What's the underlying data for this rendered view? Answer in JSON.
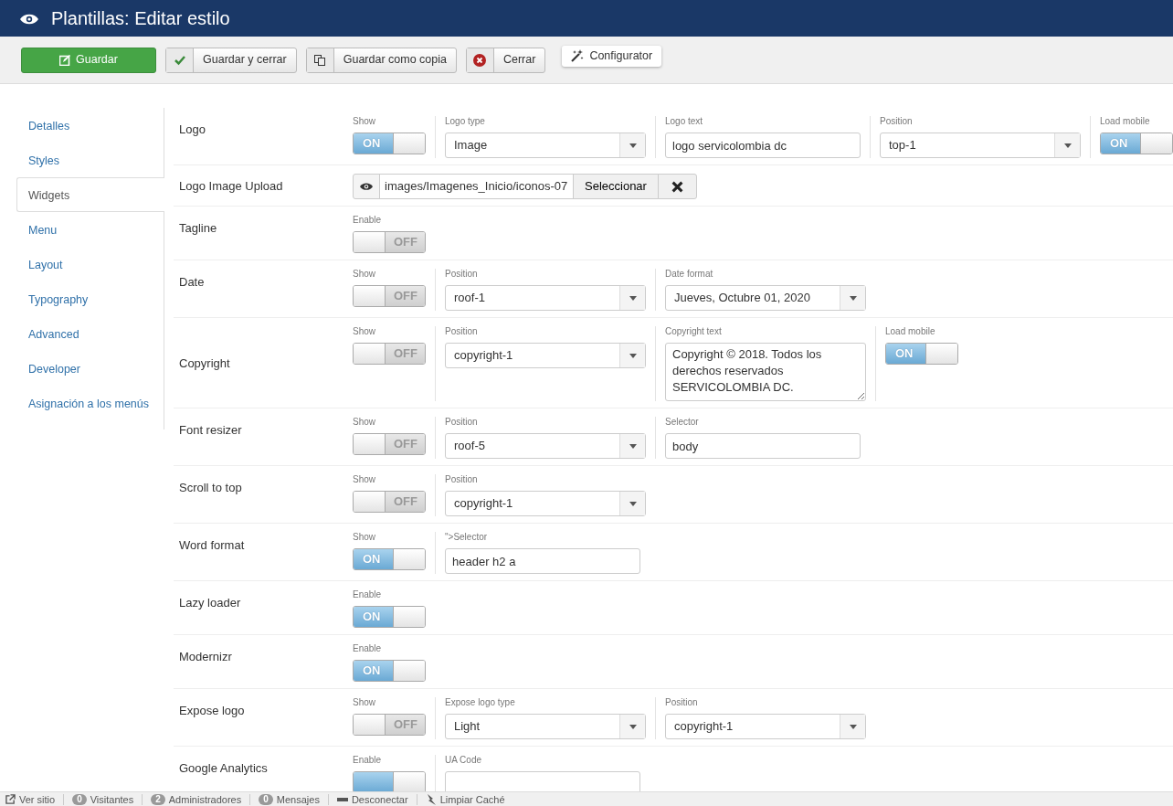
{
  "header": {
    "title": "Plantillas: Editar estilo"
  },
  "toolbar": [
    {
      "kind": "save",
      "label": "Guardar"
    },
    {
      "kind": "save-close",
      "label": "Guardar y cerrar"
    },
    {
      "kind": "save-copy",
      "label": "Guardar como copia"
    },
    {
      "kind": "close",
      "label": "Cerrar"
    },
    {
      "kind": "configurator",
      "label": "Configurator"
    }
  ],
  "sidebar": {
    "tabs": [
      {
        "label": "Detalles",
        "selected": false
      },
      {
        "label": "Styles",
        "selected": false
      },
      {
        "label": "Widgets",
        "selected": true
      },
      {
        "label": "Menu",
        "selected": false
      },
      {
        "label": "Layout",
        "selected": false
      },
      {
        "label": "Typography",
        "selected": false
      },
      {
        "label": "Advanced",
        "selected": false
      },
      {
        "label": "Developer",
        "selected": false
      },
      {
        "label": "Asignación a los menús",
        "selected": false
      }
    ]
  },
  "rows": [
    {
      "label": "Logo",
      "fields": [
        {
          "kind": "toggle",
          "caption": "Show",
          "on": true,
          "text": "ON"
        },
        {
          "kind": "select",
          "caption": "Logo type",
          "value": "Image"
        },
        {
          "kind": "text",
          "caption": "Logo text",
          "value": "logo servicolombia dc"
        },
        {
          "kind": "select",
          "caption": "Position",
          "value": "top-1"
        },
        {
          "kind": "toggle",
          "caption": "Load mobile",
          "on": true,
          "text": "ON"
        }
      ]
    },
    {
      "label": "Logo Image Upload",
      "fields": [
        {
          "kind": "media",
          "value": "images/Imagenes_Inicio/iconos-07",
          "button": "Seleccionar"
        }
      ]
    },
    {
      "label": "Tagline",
      "fields": [
        {
          "kind": "toggle",
          "caption": "Enable",
          "on": false,
          "text": "OFF"
        }
      ]
    },
    {
      "label": "Date",
      "fields": [
        {
          "kind": "toggle",
          "caption": "Show",
          "on": false,
          "text": "OFF"
        },
        {
          "kind": "select",
          "caption": "Position",
          "value": "roof-1"
        },
        {
          "kind": "select",
          "caption": "Date format",
          "value": "Jueves, Octubre 01, 2020"
        }
      ]
    },
    {
      "label": "Copyright",
      "fields": [
        {
          "kind": "toggle",
          "caption": "Show",
          "on": false,
          "text": "OFF"
        },
        {
          "kind": "select",
          "caption": "Position",
          "value": "copyright-1"
        },
        {
          "kind": "textarea",
          "caption": "Copyright text",
          "value": "Copyright © 2018. Todos los derechos reservados SERVICOLOMBIA DC."
        },
        {
          "kind": "toggle",
          "caption": "Load mobile",
          "on": true,
          "text": "ON"
        }
      ]
    },
    {
      "label": "Font resizer",
      "fields": [
        {
          "kind": "toggle",
          "caption": "Show",
          "on": false,
          "text": "OFF"
        },
        {
          "kind": "select",
          "caption": "Position",
          "value": "roof-5"
        },
        {
          "kind": "text",
          "caption": "Selector",
          "value": "body"
        }
      ]
    },
    {
      "label": "Scroll to top",
      "fields": [
        {
          "kind": "toggle",
          "caption": "Show",
          "on": false,
          "text": "OFF"
        },
        {
          "kind": "select",
          "caption": "Position",
          "value": "copyright-1"
        }
      ]
    },
    {
      "label": "Word format",
      "fields": [
        {
          "kind": "toggle",
          "caption": "Show",
          "on": true,
          "text": "ON"
        },
        {
          "kind": "text",
          "caption": "\">Selector",
          "value": "header h2 a"
        }
      ]
    },
    {
      "label": "Lazy loader",
      "fields": [
        {
          "kind": "toggle",
          "caption": "Enable",
          "on": true,
          "text": "ON"
        }
      ]
    },
    {
      "label": "Modernizr",
      "fields": [
        {
          "kind": "toggle",
          "caption": "Enable",
          "on": true,
          "text": "ON"
        }
      ]
    },
    {
      "label": "Expose logo",
      "fields": [
        {
          "kind": "toggle",
          "caption": "Show",
          "on": false,
          "text": "OFF"
        },
        {
          "kind": "select",
          "caption": "Expose logo type",
          "value": "Light"
        },
        {
          "kind": "select",
          "caption": "Position",
          "value": "copyright-1"
        }
      ]
    },
    {
      "label": "Google Analytics",
      "fields": [
        {
          "kind": "toggle",
          "caption": "Enable",
          "on": true
        },
        {
          "kind": "text",
          "caption": "UA Code"
        }
      ]
    }
  ],
  "status_bar": [
    {
      "kind": "link",
      "text": "Ver sitio"
    },
    {
      "kind": "count",
      "badge": "0",
      "text": "Visitantes"
    },
    {
      "kind": "count",
      "badge": "2",
      "text": "Administradores"
    },
    {
      "kind": "count",
      "badge": "0",
      "text": "Mensajes"
    },
    {
      "kind": "logout",
      "text": "Desconectar"
    },
    {
      "kind": "cache",
      "text": "Limpiar Caché"
    }
  ]
}
